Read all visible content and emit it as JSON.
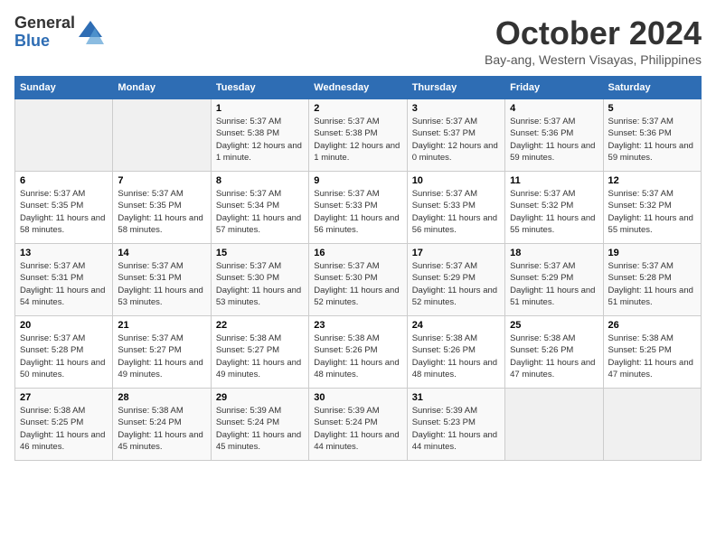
{
  "header": {
    "logo": {
      "general": "General",
      "blue": "Blue"
    },
    "title": "October 2024",
    "location": "Bay-ang, Western Visayas, Philippines"
  },
  "weekdays": [
    "Sunday",
    "Monday",
    "Tuesday",
    "Wednesday",
    "Thursday",
    "Friday",
    "Saturday"
  ],
  "weeks": [
    [
      null,
      null,
      {
        "day": 1,
        "sunrise": "Sunrise: 5:37 AM",
        "sunset": "Sunset: 5:38 PM",
        "daylight": "Daylight: 12 hours and 1 minute."
      },
      {
        "day": 2,
        "sunrise": "Sunrise: 5:37 AM",
        "sunset": "Sunset: 5:38 PM",
        "daylight": "Daylight: 12 hours and 1 minute."
      },
      {
        "day": 3,
        "sunrise": "Sunrise: 5:37 AM",
        "sunset": "Sunset: 5:37 PM",
        "daylight": "Daylight: 12 hours and 0 minutes."
      },
      {
        "day": 4,
        "sunrise": "Sunrise: 5:37 AM",
        "sunset": "Sunset: 5:36 PM",
        "daylight": "Daylight: 11 hours and 59 minutes."
      },
      {
        "day": 5,
        "sunrise": "Sunrise: 5:37 AM",
        "sunset": "Sunset: 5:36 PM",
        "daylight": "Daylight: 11 hours and 59 minutes."
      }
    ],
    [
      {
        "day": 6,
        "sunrise": "Sunrise: 5:37 AM",
        "sunset": "Sunset: 5:35 PM",
        "daylight": "Daylight: 11 hours and 58 minutes."
      },
      {
        "day": 7,
        "sunrise": "Sunrise: 5:37 AM",
        "sunset": "Sunset: 5:35 PM",
        "daylight": "Daylight: 11 hours and 58 minutes."
      },
      {
        "day": 8,
        "sunrise": "Sunrise: 5:37 AM",
        "sunset": "Sunset: 5:34 PM",
        "daylight": "Daylight: 11 hours and 57 minutes."
      },
      {
        "day": 9,
        "sunrise": "Sunrise: 5:37 AM",
        "sunset": "Sunset: 5:33 PM",
        "daylight": "Daylight: 11 hours and 56 minutes."
      },
      {
        "day": 10,
        "sunrise": "Sunrise: 5:37 AM",
        "sunset": "Sunset: 5:33 PM",
        "daylight": "Daylight: 11 hours and 56 minutes."
      },
      {
        "day": 11,
        "sunrise": "Sunrise: 5:37 AM",
        "sunset": "Sunset: 5:32 PM",
        "daylight": "Daylight: 11 hours and 55 minutes."
      },
      {
        "day": 12,
        "sunrise": "Sunrise: 5:37 AM",
        "sunset": "Sunset: 5:32 PM",
        "daylight": "Daylight: 11 hours and 55 minutes."
      }
    ],
    [
      {
        "day": 13,
        "sunrise": "Sunrise: 5:37 AM",
        "sunset": "Sunset: 5:31 PM",
        "daylight": "Daylight: 11 hours and 54 minutes."
      },
      {
        "day": 14,
        "sunrise": "Sunrise: 5:37 AM",
        "sunset": "Sunset: 5:31 PM",
        "daylight": "Daylight: 11 hours and 53 minutes."
      },
      {
        "day": 15,
        "sunrise": "Sunrise: 5:37 AM",
        "sunset": "Sunset: 5:30 PM",
        "daylight": "Daylight: 11 hours and 53 minutes."
      },
      {
        "day": 16,
        "sunrise": "Sunrise: 5:37 AM",
        "sunset": "Sunset: 5:30 PM",
        "daylight": "Daylight: 11 hours and 52 minutes."
      },
      {
        "day": 17,
        "sunrise": "Sunrise: 5:37 AM",
        "sunset": "Sunset: 5:29 PM",
        "daylight": "Daylight: 11 hours and 52 minutes."
      },
      {
        "day": 18,
        "sunrise": "Sunrise: 5:37 AM",
        "sunset": "Sunset: 5:29 PM",
        "daylight": "Daylight: 11 hours and 51 minutes."
      },
      {
        "day": 19,
        "sunrise": "Sunrise: 5:37 AM",
        "sunset": "Sunset: 5:28 PM",
        "daylight": "Daylight: 11 hours and 51 minutes."
      }
    ],
    [
      {
        "day": 20,
        "sunrise": "Sunrise: 5:37 AM",
        "sunset": "Sunset: 5:28 PM",
        "daylight": "Daylight: 11 hours and 50 minutes."
      },
      {
        "day": 21,
        "sunrise": "Sunrise: 5:37 AM",
        "sunset": "Sunset: 5:27 PM",
        "daylight": "Daylight: 11 hours and 49 minutes."
      },
      {
        "day": 22,
        "sunrise": "Sunrise: 5:38 AM",
        "sunset": "Sunset: 5:27 PM",
        "daylight": "Daylight: 11 hours and 49 minutes."
      },
      {
        "day": 23,
        "sunrise": "Sunrise: 5:38 AM",
        "sunset": "Sunset: 5:26 PM",
        "daylight": "Daylight: 11 hours and 48 minutes."
      },
      {
        "day": 24,
        "sunrise": "Sunrise: 5:38 AM",
        "sunset": "Sunset: 5:26 PM",
        "daylight": "Daylight: 11 hours and 48 minutes."
      },
      {
        "day": 25,
        "sunrise": "Sunrise: 5:38 AM",
        "sunset": "Sunset: 5:26 PM",
        "daylight": "Daylight: 11 hours and 47 minutes."
      },
      {
        "day": 26,
        "sunrise": "Sunrise: 5:38 AM",
        "sunset": "Sunset: 5:25 PM",
        "daylight": "Daylight: 11 hours and 47 minutes."
      }
    ],
    [
      {
        "day": 27,
        "sunrise": "Sunrise: 5:38 AM",
        "sunset": "Sunset: 5:25 PM",
        "daylight": "Daylight: 11 hours and 46 minutes."
      },
      {
        "day": 28,
        "sunrise": "Sunrise: 5:38 AM",
        "sunset": "Sunset: 5:24 PM",
        "daylight": "Daylight: 11 hours and 45 minutes."
      },
      {
        "day": 29,
        "sunrise": "Sunrise: 5:39 AM",
        "sunset": "Sunset: 5:24 PM",
        "daylight": "Daylight: 11 hours and 45 minutes."
      },
      {
        "day": 30,
        "sunrise": "Sunrise: 5:39 AM",
        "sunset": "Sunset: 5:24 PM",
        "daylight": "Daylight: 11 hours and 44 minutes."
      },
      {
        "day": 31,
        "sunrise": "Sunrise: 5:39 AM",
        "sunset": "Sunset: 5:23 PM",
        "daylight": "Daylight: 11 hours and 44 minutes."
      },
      null,
      null
    ]
  ]
}
